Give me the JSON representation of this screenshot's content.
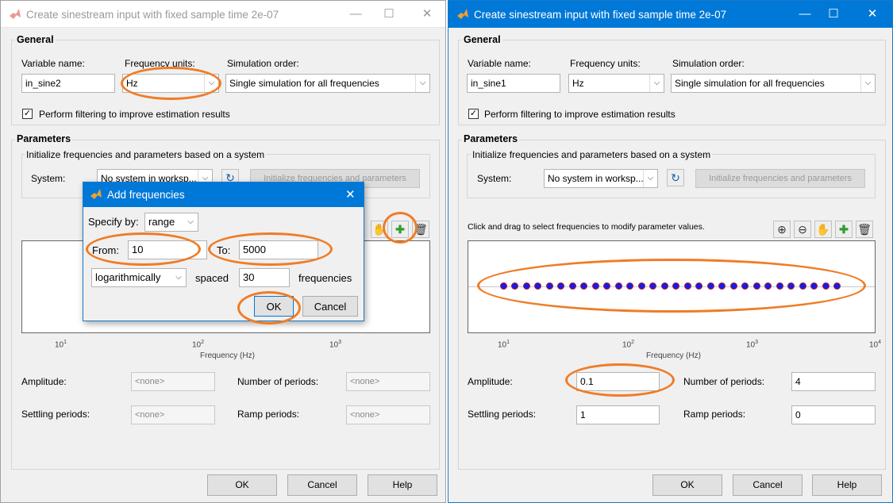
{
  "left": {
    "title": "Create sinestream input with fixed sample time 2e-07",
    "general": {
      "title": "General",
      "variable_label": "Variable name:",
      "variable_value": "in_sine2",
      "freq_units_label": "Frequency units:",
      "freq_units_value": "Hz",
      "sim_order_label": "Simulation order:",
      "sim_order_value": "Single simulation for all frequencies",
      "filter_label": "Perform filtering to improve estimation results"
    },
    "parameters": {
      "title": "Parameters",
      "init_title": "Initialize frequencies and parameters based on a system",
      "system_label": "System:",
      "system_value": "No system in worksp...",
      "init_button": "Initialize frequencies and parameters",
      "xticks": [
        "10",
        "10",
        "10"
      ],
      "xtick_exps": [
        "1",
        "2",
        "3"
      ],
      "xlabel": "Frequency (Hz)",
      "amplitude_label": "Amplitude:",
      "amplitude_value": "<none>",
      "num_periods_label": "Number of periods:",
      "num_periods_value": "<none>",
      "settling_label": "Settling periods:",
      "settling_value": "<none>",
      "ramp_label": "Ramp periods:",
      "ramp_value": "<none>"
    },
    "buttons": {
      "ok": "OK",
      "cancel": "Cancel",
      "help": "Help"
    }
  },
  "dialog": {
    "title": "Add frequencies",
    "specify_label": "Specify by:",
    "specify_value": "range",
    "from_label": "From:",
    "from_value": "10",
    "to_label": "To:",
    "to_value": "5000",
    "spacing_value": "logarithmically",
    "spaced_label": "spaced",
    "count_value": "30",
    "frequencies_label": "frequencies",
    "ok": "OK",
    "cancel": "Cancel"
  },
  "right": {
    "title": "Create sinestream input with fixed sample time 2e-07",
    "general": {
      "title": "General",
      "variable_label": "Variable name:",
      "variable_value": "in_sine1",
      "freq_units_label": "Frequency units:",
      "freq_units_value": "Hz",
      "sim_order_label": "Simulation order:",
      "sim_order_value": "Single simulation for all frequencies",
      "filter_label": "Perform filtering to improve estimation results"
    },
    "parameters": {
      "title": "Parameters",
      "init_title": "Initialize frequencies and parameters based on a system",
      "system_label": "System:",
      "system_value": "No system in worksp...",
      "init_button": "Initialize frequencies and parameters",
      "hint": "Click and drag to select frequencies to modify parameter values.",
      "xticks": [
        "10",
        "10",
        "10",
        "10"
      ],
      "xtick_exps": [
        "1",
        "2",
        "3",
        "4"
      ],
      "xlabel": "Frequency (Hz)",
      "amplitude_label": "Amplitude:",
      "amplitude_value": "0.1",
      "num_periods_label": "Number of periods:",
      "num_periods_value": "4",
      "settling_label": "Settling periods:",
      "settling_value": "1",
      "ramp_label": "Ramp periods:",
      "ramp_value": "0"
    },
    "buttons": {
      "ok": "OK",
      "cancel": "Cancel",
      "help": "Help"
    }
  },
  "frequency_plot": {
    "count": 30,
    "from_hz": 10,
    "to_hz": 5000,
    "axis_min_hz": 10,
    "axis_max_hz": 10000,
    "scale": "log"
  },
  "colors": {
    "highlight": "#ef7c26",
    "title_active": "#0078d7",
    "marker_fill": "#1a1ae6",
    "marker_edge": "#b01a2a"
  }
}
